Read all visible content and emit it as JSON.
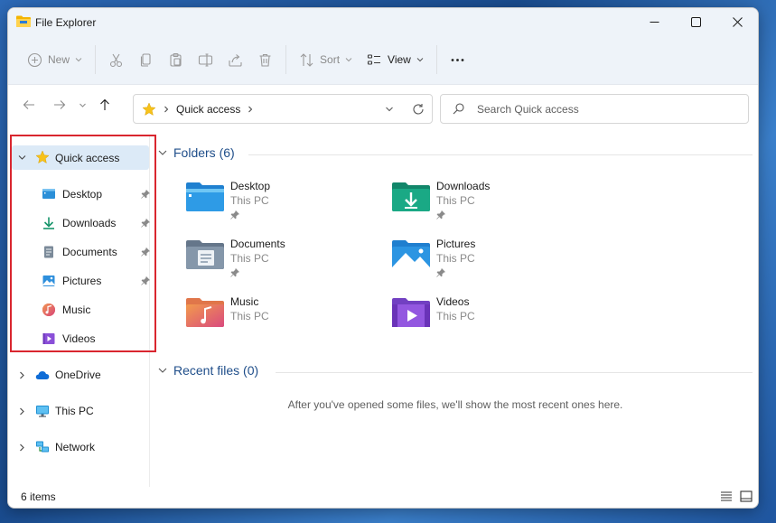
{
  "window": {
    "title": "File Explorer"
  },
  "commands": {
    "new_label": "New",
    "sort_label": "Sort",
    "view_label": "View"
  },
  "address": {
    "crumb": "Quick access"
  },
  "search": {
    "placeholder": "Search Quick access"
  },
  "nav": {
    "quick_access": "Quick access",
    "items": [
      {
        "label": "Desktop",
        "icon": "desktop-icon",
        "pinned": true
      },
      {
        "label": "Downloads",
        "icon": "downloads-icon",
        "pinned": true
      },
      {
        "label": "Documents",
        "icon": "documents-icon",
        "pinned": true
      },
      {
        "label": "Pictures",
        "icon": "pictures-icon",
        "pinned": true
      },
      {
        "label": "Music",
        "icon": "music-icon",
        "pinned": false
      },
      {
        "label": "Videos",
        "icon": "videos-icon",
        "pinned": false
      }
    ],
    "onedrive": "OneDrive",
    "thispc": "This PC",
    "network": "Network"
  },
  "folders": {
    "header": "Folders (6)",
    "tiles": [
      {
        "name": "Desktop",
        "location": "This PC",
        "pinned": true
      },
      {
        "name": "Downloads",
        "location": "This PC",
        "pinned": true
      },
      {
        "name": "Documents",
        "location": "This PC",
        "pinned": true
      },
      {
        "name": "Pictures",
        "location": "This PC",
        "pinned": true
      },
      {
        "name": "Music",
        "location": "This PC",
        "pinned": false
      },
      {
        "name": "Videos",
        "location": "This PC",
        "pinned": false
      }
    ]
  },
  "recent": {
    "header": "Recent files (0)",
    "empty_message": "After you've opened some files, we'll show the most recent ones here."
  },
  "status": {
    "items_count": "6 items"
  },
  "colors": {
    "accent": "#1f4e8a",
    "selection": "#dceaf7",
    "highlight_border": "#d9262f"
  }
}
